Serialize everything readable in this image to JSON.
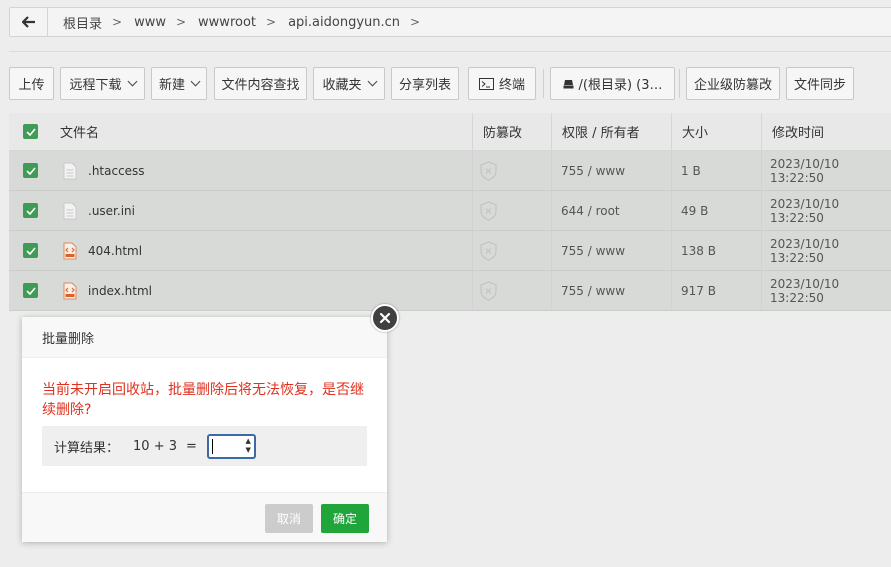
{
  "breadcrumb": {
    "items": [
      "根目录",
      "www",
      "wwwroot",
      "api.aidongyun.cn"
    ]
  },
  "toolbar": {
    "upload": "上传",
    "remote_download": "远程下载",
    "new": "新建",
    "search_content": "文件内容查找",
    "favorites": "收藏夹",
    "share_list": "分享列表",
    "terminal": "终端",
    "disk": "/(根目录) (3…",
    "tamper_proof": "企业级防篡改",
    "file_sync": "文件同步"
  },
  "table": {
    "headers": {
      "name": "文件名",
      "tamper": "防篡改",
      "perm": "权限 / 所有者",
      "size": "大小",
      "mtime": "修改时间"
    },
    "rows": [
      {
        "name": ".htaccess",
        "icon": "file-icon",
        "perm": "755 / www",
        "size": "1 B",
        "mtime": "2023/10/10 13:22:50"
      },
      {
        "name": ".user.ini",
        "icon": "file-icon",
        "perm": "644 / root",
        "size": "49 B",
        "mtime": "2023/10/10 13:22:50"
      },
      {
        "name": "404.html",
        "icon": "html-file-icon",
        "perm": "755 / www",
        "size": "138 B",
        "mtime": "2023/10/10 13:22:50"
      },
      {
        "name": "index.html",
        "icon": "html-file-icon",
        "perm": "755 / www",
        "size": "917 B",
        "mtime": "2023/10/10 13:22:50"
      }
    ]
  },
  "modal": {
    "title": "批量删除",
    "warning": "当前未开启回收站，批量删除后将无法恢复，是否继续删除?",
    "calc_label": "计算结果：",
    "calc_expr": "10 + 3",
    "calc_eq": "=",
    "calc_value": "",
    "cancel": "取消",
    "confirm": "确定"
  },
  "colors": {
    "accent_green": "#20a53a",
    "checkbox_green": "#3f9b55",
    "warning_red": "#e0301e"
  }
}
